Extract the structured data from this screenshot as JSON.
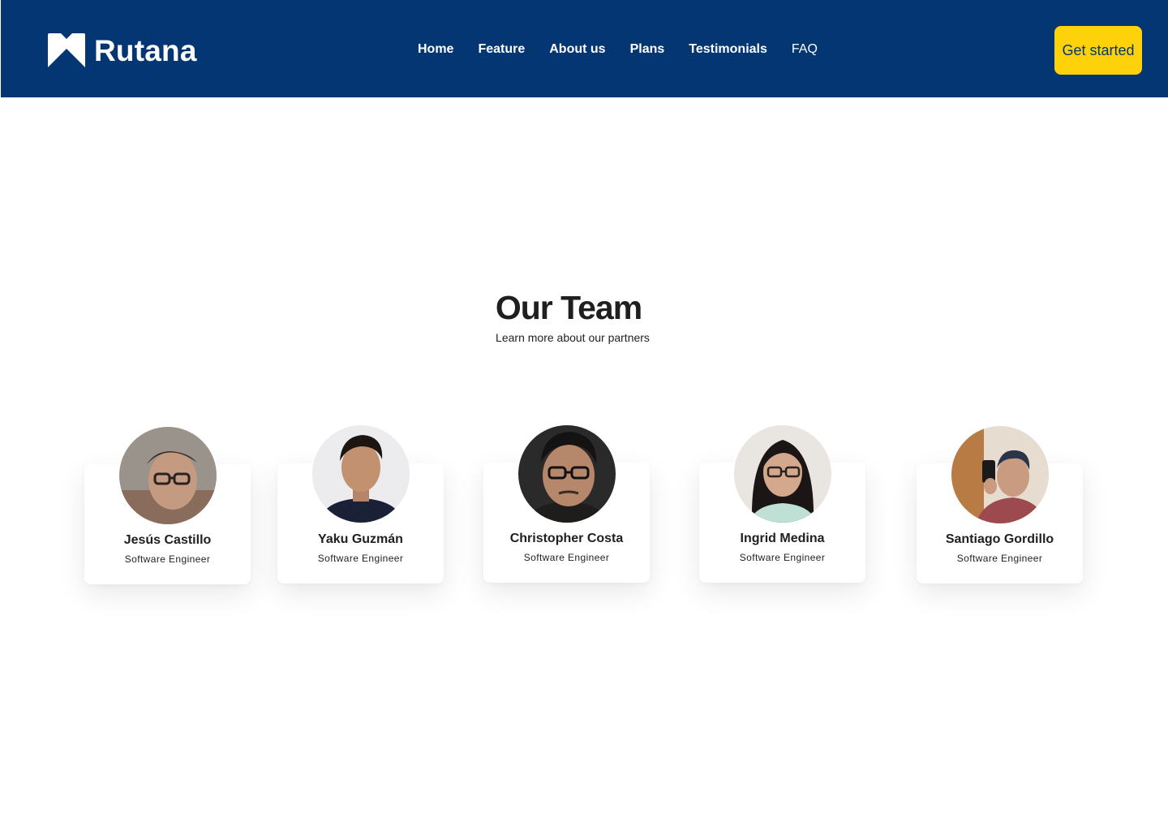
{
  "header": {
    "brand": "Rutana",
    "nav": [
      {
        "label": "Home"
      },
      {
        "label": "Feature"
      },
      {
        "label": "About us"
      },
      {
        "label": "Plans"
      },
      {
        "label": "Testimonials"
      },
      {
        "label": "FAQ"
      }
    ],
    "cta_label": "Get started"
  },
  "team": {
    "title": "Our Team",
    "subtitle": "Learn more about our partners",
    "members": [
      {
        "name": "Jesús Castillo",
        "role": "Software Engineer"
      },
      {
        "name": "Yaku Guzmán",
        "role": "Software Engineer"
      },
      {
        "name": "Christopher Costa",
        "role": "Software Engineer"
      },
      {
        "name": "Ingrid Medina",
        "role": "Software Engineer"
      },
      {
        "name": "Santiago Gordillo",
        "role": "Software Engineer"
      }
    ]
  },
  "colors": {
    "header_bg": "#043673",
    "cta_bg": "#fdd20a",
    "cta_text": "#043673",
    "nav_text": "#ffffff",
    "heading_text": "#1f1f1f"
  },
  "icons": {
    "logo": "chevron-up-logo-icon"
  }
}
